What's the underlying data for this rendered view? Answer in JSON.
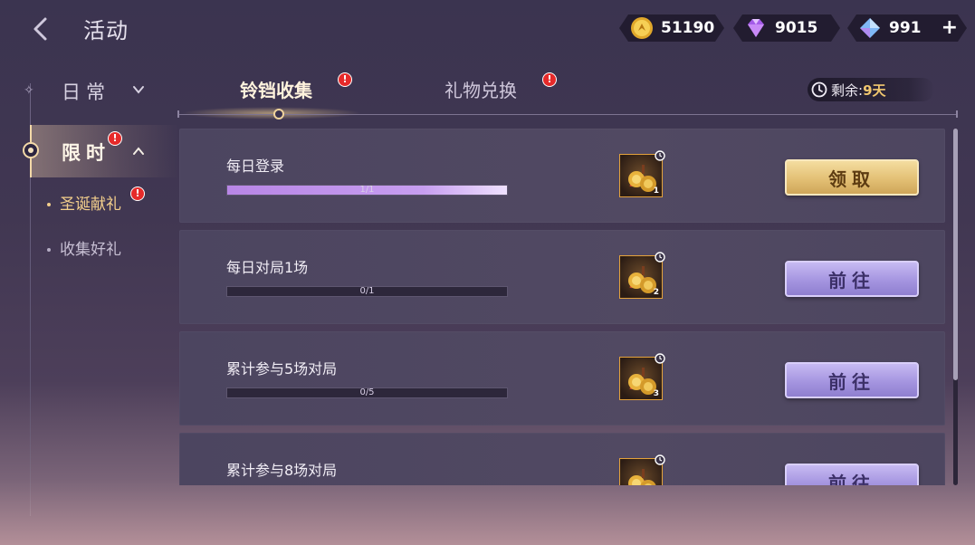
{
  "header": {
    "title": "活动",
    "currencies": [
      {
        "icon": "gold-coin-icon",
        "value": "51190"
      },
      {
        "icon": "purple-gem-icon",
        "value": "9015"
      },
      {
        "icon": "blue-diamond-icon",
        "value": "991",
        "add": "+"
      }
    ]
  },
  "sidebar": {
    "categories": [
      {
        "label": "日常",
        "expanded": false
      },
      {
        "label": "限时",
        "expanded": true,
        "badge": "!"
      }
    ],
    "sub_items": [
      {
        "label": "圣诞献礼",
        "active": true,
        "badge": "!"
      },
      {
        "label": "收集好礼",
        "active": false
      }
    ]
  },
  "tabs": [
    {
      "label": "铃铛收集",
      "active": true,
      "badge": "!"
    },
    {
      "label": "礼物兑换",
      "active": false,
      "badge": "!"
    }
  ],
  "remaining": {
    "label": "剩余:",
    "value": "9天"
  },
  "tasks": [
    {
      "title": "每日登录",
      "progress_text": "1/1",
      "progress": 1.0,
      "reward_qty": "1",
      "button": "领取",
      "button_type": "claim"
    },
    {
      "title": "每日对局1场",
      "progress_text": "0/1",
      "progress": 0.0,
      "reward_qty": "2",
      "button": "前往",
      "button_type": "goto"
    },
    {
      "title": "累计参与5场对局",
      "progress_text": "0/5",
      "progress": 0.0,
      "reward_qty": "3",
      "button": "前往",
      "button_type": "goto"
    },
    {
      "title": "累计参与8场对局",
      "progress_text": "",
      "progress": 0.0,
      "reward_qty": "",
      "button": "前往",
      "button_type": "goto"
    }
  ],
  "colors": {
    "accent_gold": "#f3cf8c",
    "badge_red": "#e62a2a",
    "progress_purple": "#b886e6"
  }
}
